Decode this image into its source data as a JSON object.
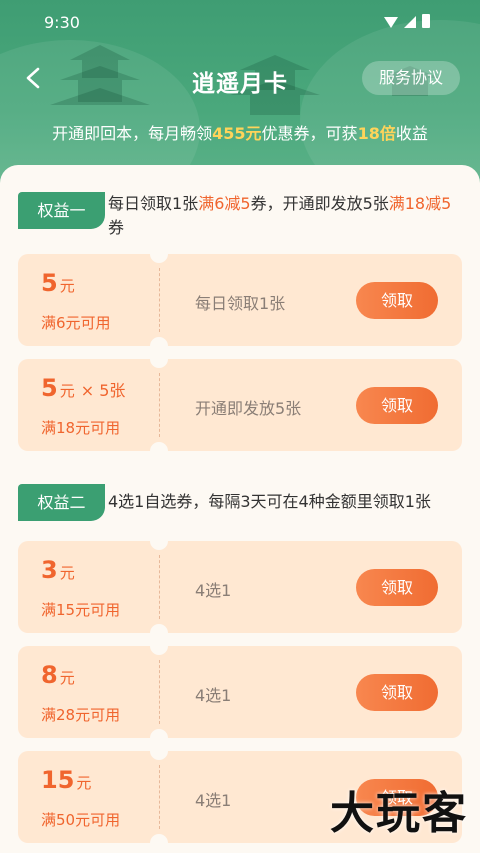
{
  "status_bar": {
    "time": "9:30"
  },
  "nav": {
    "title": "逍遥月卡",
    "agreement_label": "服务协议"
  },
  "subtitle": {
    "part1": "开通即回本，每月畅领",
    "amount": "455元",
    "part2": "优惠券，可获",
    "multiple": "18倍",
    "part3": "收益"
  },
  "benefit1": {
    "badge": "权益一",
    "text_a": "每日领取1张",
    "text_b": "满6减5",
    "text_c": "券，开通即发放5张",
    "text_d": "满18减5",
    "text_e": "券"
  },
  "benefit2": {
    "badge": "权益二",
    "text": "4选1自选券，每隔3天可在4种金额里领取1张"
  },
  "coupons": [
    {
      "amount": "5",
      "unit": "元",
      "multiplier": "",
      "condition": "满6元可用",
      "desc": "每日领取1张",
      "button": "领取"
    },
    {
      "amount": "5",
      "unit": "元",
      "multiplier": "× 5张",
      "condition": "满18元可用",
      "desc": "开通即发放5张",
      "button": "领取"
    },
    {
      "amount": "3",
      "unit": "元",
      "multiplier": "",
      "condition": "满15元可用",
      "desc": "4选1",
      "button": "领取"
    },
    {
      "amount": "8",
      "unit": "元",
      "multiplier": "",
      "condition": "满28元可用",
      "desc": "4选1",
      "button": "领取"
    },
    {
      "amount": "15",
      "unit": "元",
      "multiplier": "",
      "condition": "满50元可用",
      "desc": "4选1",
      "button": "领取"
    }
  ],
  "watermark": "大玩客",
  "colors": {
    "brand_green": "#3f9d73",
    "accent_orange": "#f0652e",
    "highlight_yellow": "#ffd45a"
  }
}
